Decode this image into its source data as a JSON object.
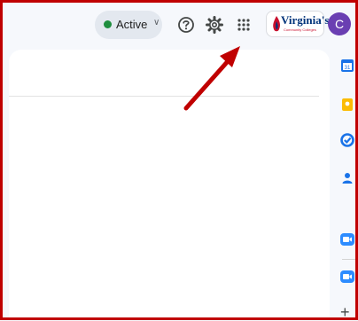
{
  "topbar": {
    "status": {
      "label": "Active",
      "color": "#1e8e3e",
      "icon": "chevron-down-icon"
    },
    "help_icon": "help-icon",
    "settings_icon": "gear-icon",
    "apps_icon": "apps-grid-icon",
    "org_logo": {
      "brand": "Virginia's",
      "subtitle": "Community Colleges"
    },
    "avatar_initial": "C"
  },
  "side_panel": {
    "items": [
      {
        "name": "calendar-icon",
        "color": "#1a73e8"
      },
      {
        "name": "keep-icon",
        "color": "#fbbc04"
      },
      {
        "name": "tasks-icon",
        "color": "#1a73e8"
      },
      {
        "name": "contacts-icon",
        "color": "#1a73e8"
      },
      {
        "name": "zoom-icon",
        "color": "#2d8cff"
      },
      {
        "name": "meet-icon",
        "color": "#2d8cff"
      }
    ],
    "add_label": "+"
  },
  "annotation": {
    "color": "#c00000"
  }
}
